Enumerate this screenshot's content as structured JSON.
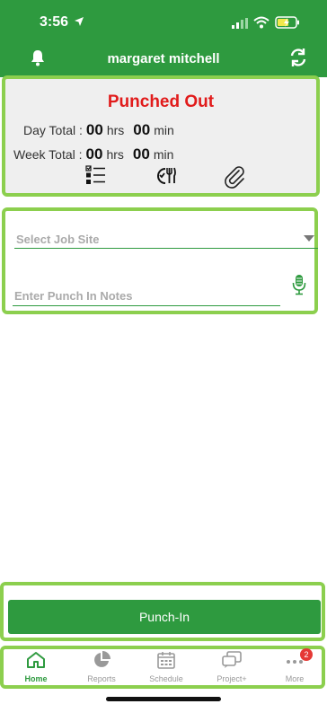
{
  "status_bar": {
    "time": "3:56"
  },
  "header": {
    "user_name": "margaret mitchell"
  },
  "status_card": {
    "punch_status": "Punched Out",
    "day_total_label": "Day Total :",
    "day_hours": "00",
    "day_minutes": "00",
    "week_total_label": "Week Total :",
    "week_hours": "00",
    "week_minutes": "00",
    "hrs_unit": "hrs",
    "min_unit": "min"
  },
  "form": {
    "job_site_placeholder": "Select Job Site",
    "notes_placeholder": "Enter Punch In Notes"
  },
  "punch_button": {
    "label": "Punch-In"
  },
  "tabbar": {
    "items": [
      {
        "label": "Home"
      },
      {
        "label": "Reports"
      },
      {
        "label": "Schedule"
      },
      {
        "label": "Project+"
      },
      {
        "label": "More"
      }
    ],
    "more_badge": "2"
  },
  "colors": {
    "header_bg": "#2e9a3f",
    "highlight_border": "#8ccf4e",
    "punch_status": "#e11b1b"
  }
}
